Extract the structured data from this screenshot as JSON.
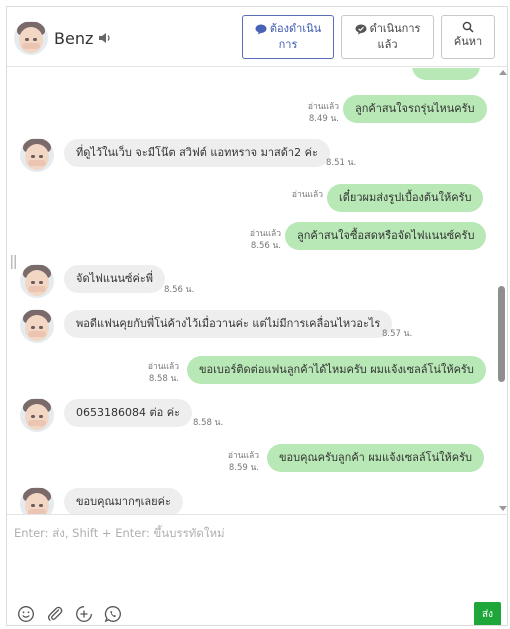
{
  "header": {
    "contact_name": "Benz",
    "buttons": [
      {
        "label_line1": "ต้องดำเนิน",
        "label_line2": "การ",
        "icon": "chat-bubble-icon"
      },
      {
        "label_line1": "ดำเนินการ",
        "label_line2": "แล้ว",
        "icon": "chat-check-icon"
      },
      {
        "label_line1": "",
        "label_line2": "ค้นหา",
        "icon": "search-icon"
      }
    ]
  },
  "messages": [
    {
      "dir": "out",
      "text": "ลูกค้าสนใจรถรุ่นไหนครับ",
      "status": "อ่านแล้ว",
      "time": "8.49 น."
    },
    {
      "dir": "in",
      "text": "ที่ดูไว้ในเว็บ จะมีโน๊ต สวิฟต์ แอทหราจ มาสด้า2 ค่ะ",
      "time": "8.51 น."
    },
    {
      "dir": "out",
      "text": "เดี๋ยวผมส่งรูปเบื้องต้นให้ครับ",
      "status": "อ่านแล้ว",
      "time": ""
    },
    {
      "dir": "out",
      "text": "ลูกค้าสนใจซื้อสดหรือจัดไฟแนนซ์ครับ",
      "status": "อ่านแล้ว",
      "time": "8.56 น."
    },
    {
      "dir": "in",
      "text": "จัดไฟแนนซ์ค่ะพี่",
      "time": "8.56 น."
    },
    {
      "dir": "in",
      "text": "พอดีแฟนคุยกับพี่โน่ค้างไว้เมื่อวานค่ะ แต่ไม่มีการเคลื่อนไหวอะไร",
      "time": "8.57 น."
    },
    {
      "dir": "out",
      "text": "ขอเบอร์ติดต่อแฟนลูกค้าได้ไหมครับ ผมแจ้งเซลล์โน่ให้ครับ",
      "status": "อ่านแล้ว",
      "time": "8.58 น."
    },
    {
      "dir": "in",
      "text": "0653186084 ต่อ ค่ะ",
      "time": "8.58 น."
    },
    {
      "dir": "out",
      "text": "ขอบคุณครับลูกค้า ผมแจ้งเซลล์โน่ให้ครับ",
      "status": "อ่านแล้ว",
      "time": "8.59 น."
    },
    {
      "dir": "in",
      "text": "ขอบคุณมากๆเลยค่ะ",
      "time": ""
    }
  ],
  "composer": {
    "placeholder": "Enter: ส่ง, Shift + Enter: ขึ้นบรรทัดใหม่",
    "value": "",
    "send_label": "ส่ง",
    "tools": [
      "emoji-icon",
      "attachment-icon",
      "add-circle-icon",
      "whatsapp-icon"
    ]
  },
  "colors": {
    "outgoing_bubble": "#b8e8b5",
    "incoming_bubble": "#eeeeee",
    "send_button": "#1fa63a",
    "active_tab": "#3f5bb0"
  }
}
